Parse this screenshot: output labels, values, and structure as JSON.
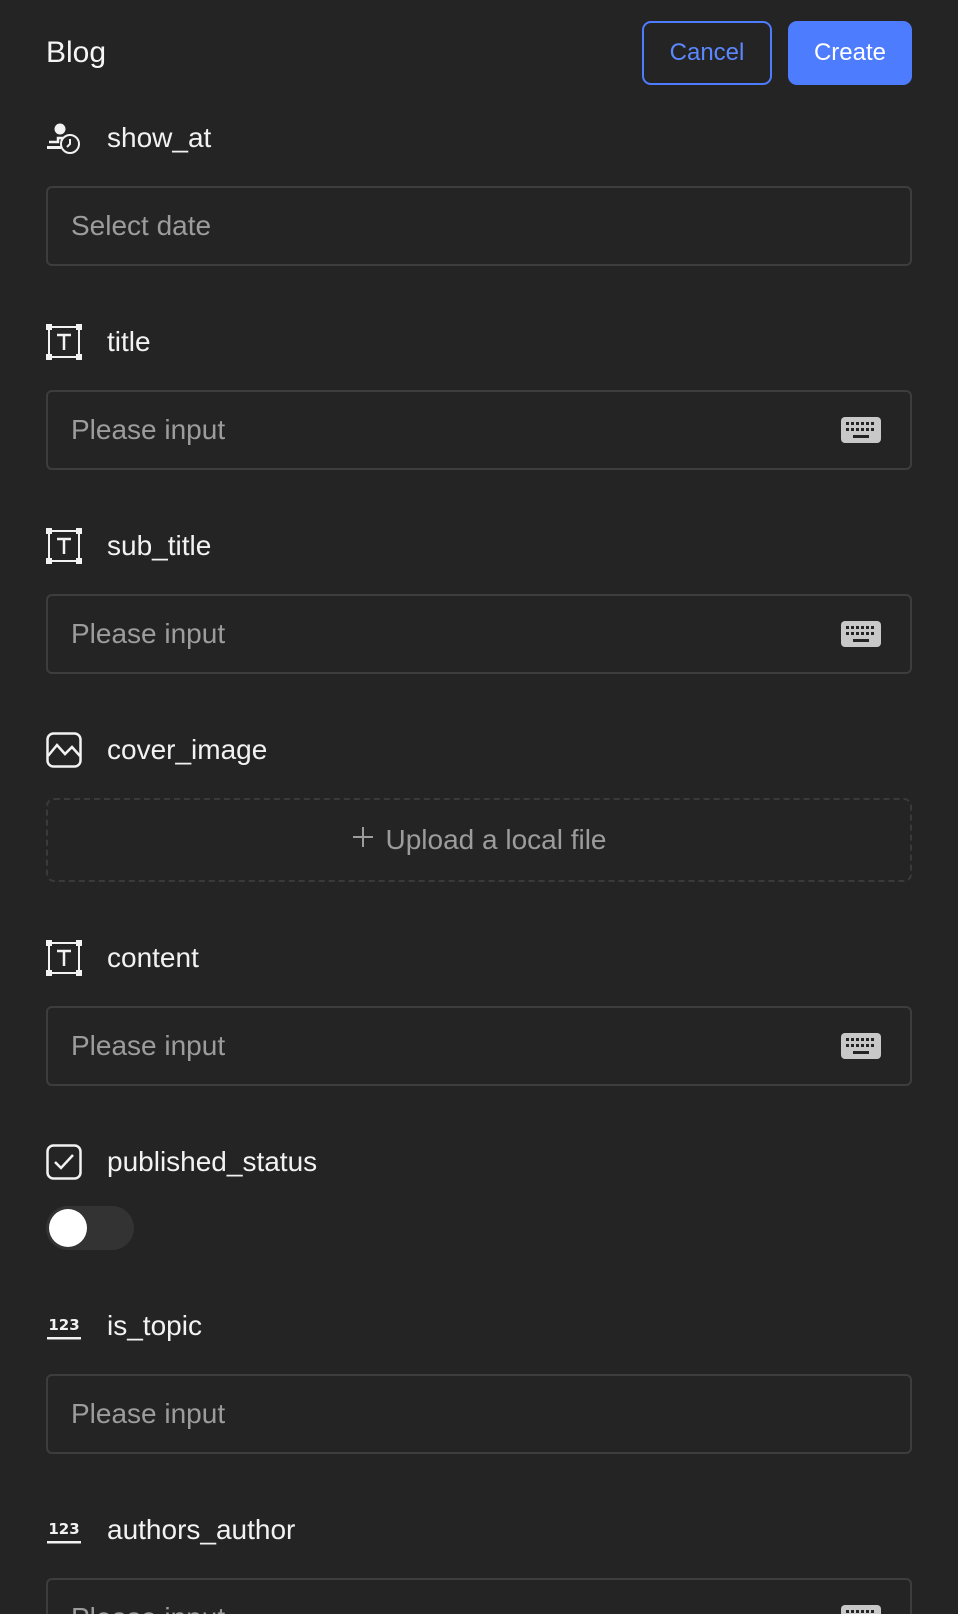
{
  "header": {
    "title": "Blog",
    "cancel_label": "Cancel",
    "create_label": "Create"
  },
  "fields": [
    {
      "label": "show_at",
      "icon": "date-time-icon",
      "type": "date",
      "placeholder": "Select date"
    },
    {
      "label": "title",
      "icon": "text-field-icon",
      "type": "text",
      "placeholder": "Please input"
    },
    {
      "label": "sub_title",
      "icon": "text-field-icon",
      "type": "text",
      "placeholder": "Please input"
    },
    {
      "label": "cover_image",
      "icon": "image-icon",
      "type": "upload",
      "upload_label": "Upload a local file"
    },
    {
      "label": "content",
      "icon": "text-field-icon",
      "type": "text",
      "placeholder": "Please input"
    },
    {
      "label": "published_status",
      "icon": "checkbox-icon",
      "type": "toggle",
      "value": false
    },
    {
      "label": "is_topic",
      "icon": "number-icon",
      "type": "number",
      "placeholder": "Please input"
    },
    {
      "label": "authors_author",
      "icon": "number-icon",
      "type": "number",
      "placeholder": "Please input"
    }
  ],
  "colors": {
    "background": "#242424",
    "accent": "#4d7cfe",
    "border": "#3d3d3d",
    "placeholder": "#9c9c9c"
  }
}
